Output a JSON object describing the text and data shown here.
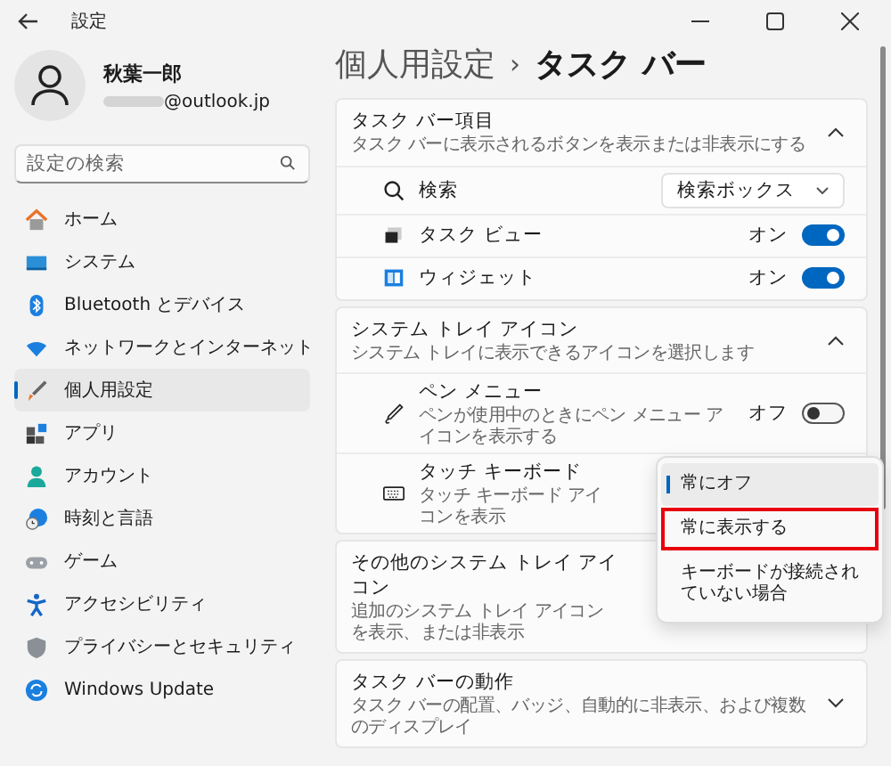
{
  "window": {
    "title": "設定"
  },
  "user": {
    "name": "秋葉一郎",
    "email": "@outlook.jp"
  },
  "search": {
    "placeholder": "設定の検索"
  },
  "nav": [
    {
      "label": "ホーム",
      "selected": false
    },
    {
      "label": "システム",
      "selected": false
    },
    {
      "label": "Bluetooth とデバイス",
      "selected": false
    },
    {
      "label": "ネットワークとインターネット",
      "selected": false
    },
    {
      "label": "個人用設定",
      "selected": true
    },
    {
      "label": "アプリ",
      "selected": false
    },
    {
      "label": "アカウント",
      "selected": false
    },
    {
      "label": "時刻と言語",
      "selected": false
    },
    {
      "label": "ゲーム",
      "selected": false
    },
    {
      "label": "アクセシビリティ",
      "selected": false
    },
    {
      "label": "プライバシーとセキュリティ",
      "selected": false
    },
    {
      "label": "Windows Update",
      "selected": false
    }
  ],
  "breadcrumb": {
    "parent": "個人用設定",
    "separator": "›",
    "current": "タスク バー"
  },
  "sections": [
    {
      "title": "タスク バー項目",
      "subtitle": "タスク バーに表示されるボタンを表示または非表示にする",
      "expanded": true,
      "rows": [
        {
          "kind": "dropdown",
          "label": "検索",
          "value": "検索ボックス"
        },
        {
          "kind": "toggle",
          "label": "タスク ビュー",
          "state": "オン",
          "on": true
        },
        {
          "kind": "toggle",
          "label": "ウィジェット",
          "state": "オン",
          "on": true
        }
      ]
    },
    {
      "title": "システム トレイ アイコン",
      "subtitle": "システム トレイに表示できるアイコンを選択します",
      "expanded": true,
      "rows": [
        {
          "kind": "toggle",
          "label": "ペン メニュー",
          "description": "ペンが使用中のときにペン メニュー アイコンを表示する",
          "state": "オフ",
          "on": false
        },
        {
          "kind": "menu",
          "label": "タッチ キーボード",
          "description": "タッチ キーボード アイコンを表示"
        }
      ]
    },
    {
      "title": "その他のシステム トレイ アイコン",
      "subtitle": "追加のシステム トレイ アイコンを表示、または非表示"
    },
    {
      "title": "タスク バーの動作",
      "subtitle": "タスク バーの配置、バッジ、自動的に非表示、および複数のディスプレイ",
      "expanded": false
    }
  ],
  "menu": {
    "options": [
      {
        "label": "常にオフ",
        "selected": true,
        "highlighted": false
      },
      {
        "label": "常に表示する",
        "selected": false,
        "highlighted": true
      },
      {
        "label": "キーボードが接続されていない場合",
        "selected": false,
        "highlighted": false
      }
    ]
  }
}
